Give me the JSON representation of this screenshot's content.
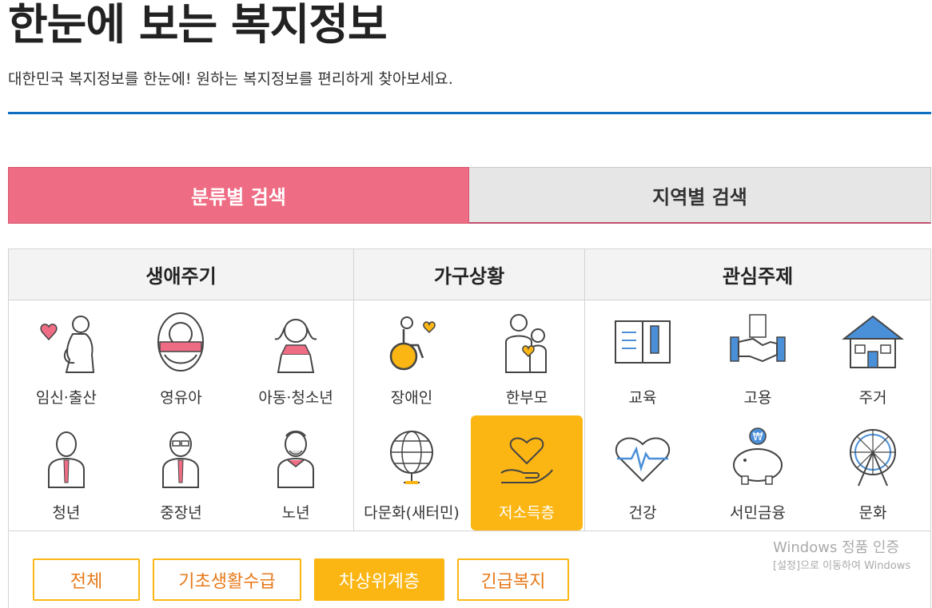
{
  "header": {
    "title": "한눈에 보는 복지정보",
    "subtitle": "대한민국 복지정보를 한눈에! 원하는 복지정보를 편리하게 찾아보세요."
  },
  "search_tabs": {
    "by_category": "분류별 검색",
    "by_region": "지역별 검색"
  },
  "panel": {
    "headers": {
      "life": "생애주기",
      "household": "가구상황",
      "interest": "관심주제"
    },
    "life_items": [
      {
        "label": "임신·출산",
        "icon": "pregnancy-icon"
      },
      {
        "label": "영유아",
        "icon": "infant-icon"
      },
      {
        "label": "아동·청소년",
        "icon": "child-youth-icon"
      },
      {
        "label": "청년",
        "icon": "young-adult-icon"
      },
      {
        "label": "중장년",
        "icon": "middle-aged-icon"
      },
      {
        "label": "노년",
        "icon": "elderly-icon"
      }
    ],
    "household_items": [
      {
        "label": "장애인",
        "icon": "disabled-icon"
      },
      {
        "label": "한부모",
        "icon": "single-parent-icon"
      },
      {
        "label": "다문화(새터민)",
        "icon": "globe-icon"
      },
      {
        "label": "저소득층",
        "icon": "heart-hand-icon",
        "selected": true
      }
    ],
    "interest_items": [
      {
        "label": "교육",
        "icon": "book-icon"
      },
      {
        "label": "고용",
        "icon": "handshake-icon"
      },
      {
        "label": "주거",
        "icon": "house-icon"
      },
      {
        "label": "건강",
        "icon": "heartbeat-icon"
      },
      {
        "label": "서민금융",
        "icon": "piggy-bank-icon"
      },
      {
        "label": "문화",
        "icon": "ferris-wheel-icon"
      }
    ]
  },
  "filters": {
    "all": "전체",
    "basic_living": "기초생활수급",
    "near_poverty": "차상위계층",
    "emergency": "긴급복지",
    "active": "차상위계층"
  },
  "watermark": {
    "title": "Windows 정품 인증",
    "subtitle": "[설정]으로 이동하여 Windows"
  },
  "colors": {
    "accent_blue": "#0f6fc0",
    "tab_pink": "#ef6d84",
    "highlight_yellow": "#fbb614",
    "filter_text_orange": "#e87817"
  }
}
